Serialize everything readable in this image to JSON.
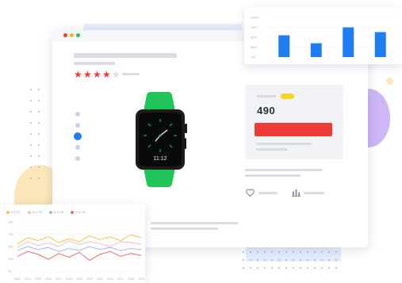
{
  "colors": {
    "accent_blue": "#1d7ff3",
    "watch_green": "#1fc55a",
    "buy_red": "#ef3b36",
    "badge_yellow": "#f7d31c",
    "star_red": "#ef3b36",
    "star_gray": "#d9dde3",
    "purple": "#c7a9f4",
    "sand": "#fbe7b9"
  },
  "product": {
    "price": "490",
    "rating": 4,
    "rating_max": 5,
    "watch_time": "11:12"
  },
  "icons": {
    "star": "★",
    "heart": "heart-icon",
    "compare": "bar-chart-icon"
  },
  "pager": {
    "count": 5,
    "active_index": 3
  },
  "chart_data": [
    {
      "type": "bar",
      "y_ticks": [
        "100%",
        "75%",
        "50%",
        "25%",
        "0%"
      ],
      "categories": [
        "",
        "",
        "",
        ""
      ],
      "values": [
        55,
        35,
        75,
        63
      ],
      "ylim": [
        0,
        100
      ],
      "grid": true
    },
    {
      "type": "line",
      "legend": [
        {
          "label": "% YTD",
          "color": "#f6c34a"
        },
        {
          "label": "% 1 YR",
          "color": "#f4bcc0"
        },
        {
          "label": "% 3 YR",
          "color": "#a8b7e8"
        },
        {
          "label": "% 5 YR",
          "color": "#ef6a6a"
        }
      ],
      "y_ticks": [
        "100",
        "75%",
        "50%",
        "25%",
        "0%"
      ],
      "x_ticks": [
        "2020",
        "2014",
        "2015",
        "2016",
        "2017",
        "2018",
        "2019",
        "2020",
        "2015",
        "2016",
        "2017",
        "2018",
        "2019"
      ],
      "ylim": [
        0,
        100
      ],
      "grid": true,
      "series": [
        {
          "values": [
            55,
            68,
            62,
            70,
            58,
            66,
            60,
            72,
            64,
            70,
            62,
            74,
            68
          ]
        },
        {
          "values": [
            48,
            60,
            52,
            58,
            50,
            62,
            54,
            60,
            56,
            50,
            60,
            58,
            54
          ]
        },
        {
          "values": [
            42,
            50,
            44,
            48,
            40,
            46,
            42,
            50,
            44,
            48,
            42,
            46,
            44
          ]
        },
        {
          "values": [
            30,
            40,
            34,
            24,
            36,
            28,
            38,
            22,
            34,
            40,
            30,
            36,
            32
          ]
        }
      ]
    }
  ]
}
